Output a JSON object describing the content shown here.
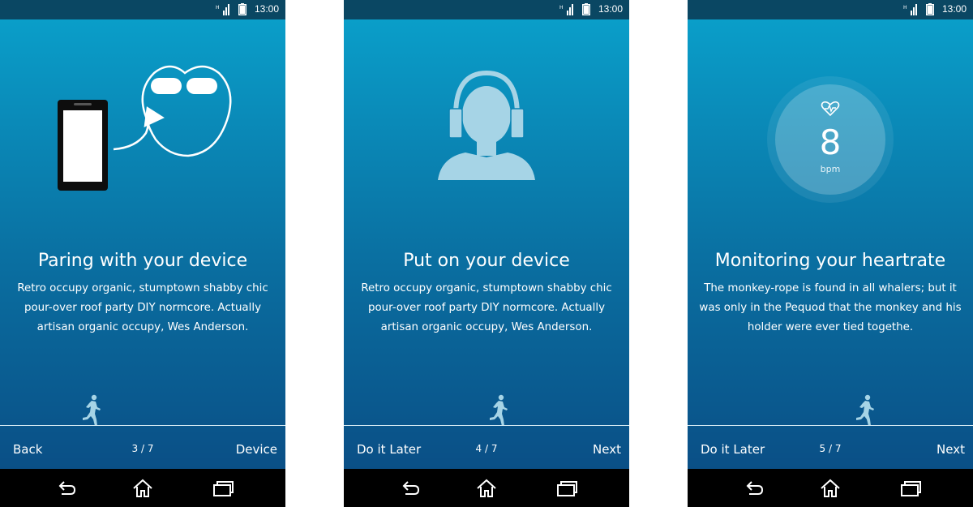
{
  "status_bar": {
    "time": "13:00"
  },
  "screens": [
    {
      "title": "Paring with your device",
      "body": "Retro occupy organic, stumptown shabby chic pour-over roof party DIY normcore. Actually artisan organic occupy, Wes Anderson.",
      "left_button": "Back",
      "page": "3 / 7",
      "right_button": "Device"
    },
    {
      "title": "Put on your device",
      "body": "Retro occupy organic, stumptown shabby chic pour-over roof party DIY normcore. Actually artisan organic occupy, Wes Anderson.",
      "left_button": "Do it Later",
      "page": "4 / 7",
      "right_button": "Next"
    },
    {
      "title": "Monitoring your heartrate",
      "body": "The monkey-rope is found in all whalers; but it was only in the Pequod that the monkey and his holder were ever tied togethe.",
      "left_button": "Do it Later",
      "page": "5 / 7",
      "right_button": "Next",
      "heart_rate": {
        "value": "8",
        "unit": "bpm"
      }
    }
  ],
  "colors": {
    "gradient_top": "#0a9ec9",
    "gradient_bottom": "#0a4f86",
    "status_bar": "#0a4763",
    "nav_bar": "#000000",
    "illustration": "#a6d4e6"
  },
  "icons": {
    "nav_back": "back-arrow-icon",
    "nav_home": "home-icon",
    "nav_recent": "recent-apps-icon",
    "status_signal": "signal-icon",
    "status_battery": "battery-icon"
  }
}
